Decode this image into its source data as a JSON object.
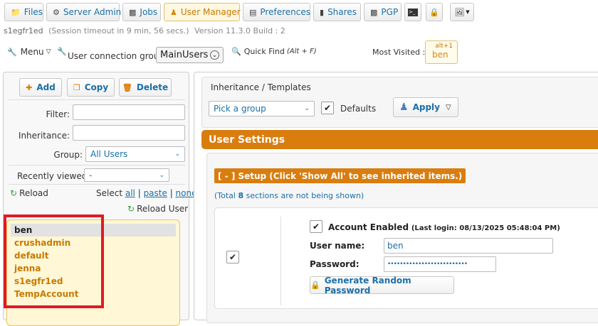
{
  "toolbar": {
    "tabs": [
      {
        "label": "Files",
        "icon": "folder-icon"
      },
      {
        "label": "Server Admin",
        "icon": "gear-icon"
      },
      {
        "label": "Jobs",
        "icon": "jobs-icon"
      },
      {
        "label": "User Manager",
        "icon": "user-icon"
      },
      {
        "label": "Preferences",
        "icon": "preferences-icon"
      },
      {
        "label": "Shares",
        "icon": "shares-icon"
      },
      {
        "label": "PGP",
        "icon": "pgp-icon"
      }
    ]
  },
  "session": {
    "user": "s1egfr1ed",
    "timeout": "(Session timeout in 9 min, 56 secs.)",
    "version": "Version 11.3.0 Build : 2"
  },
  "subbar": {
    "menu_label": "Menu",
    "connection_group_label": "User connection group:",
    "connection_group_value": "MainUsers",
    "quick_find_label": "Quick Find",
    "quick_find_shortcut": "(Alt + F)",
    "most_visited_label": "Most Visited :",
    "most_visited_shortcut": "alt+1",
    "most_visited_user": "ben"
  },
  "left_panel": {
    "add_label": "Add",
    "copy_label": "Copy",
    "delete_label": "Delete",
    "filter_label": "Filter:",
    "filter_value": "",
    "inheritance_label": "Inheritance:",
    "inheritance_value": "",
    "group_label": "Group:",
    "group_value": "All Users",
    "recently_viewed_label": "Recently viewed:",
    "recently_viewed_value": "-",
    "reload_label": "Reload",
    "select_label": "Select",
    "select_all": "all",
    "select_paste": "paste",
    "select_none": "none",
    "reload_user_label": "Reload User",
    "users": [
      "ben",
      "crushadmin",
      "default",
      "jenna",
      "s1egfr1ed",
      "TempAccount"
    ]
  },
  "right_panel": {
    "inheritance_title": "Inheritance / Templates",
    "pick_group_value": "Pick a group",
    "defaults_label": "Defaults",
    "apply_label": "Apply",
    "user_settings_title": "User Settings",
    "setup_header": "[ - ] Setup (Click 'Show All' to see inherited items.)",
    "total_prefix": "(Total ",
    "total_count": "8",
    "total_suffix": " sections are not being shown)",
    "account_enabled_label": "Account Enabled",
    "last_login": "(Last login: 08/13/2025 05:48:04 PM)",
    "username_label": "User name:",
    "username_value": "ben",
    "password_label": "Password:",
    "password_value": "••••••••••••••••••••••••••",
    "generate_password_label": "Generate Random Password"
  },
  "colors": {
    "accent": "#d97d0f",
    "link": "#1b6fa8",
    "highlight_border": "#e01b24",
    "user_list_bg": "#fff7d6"
  }
}
